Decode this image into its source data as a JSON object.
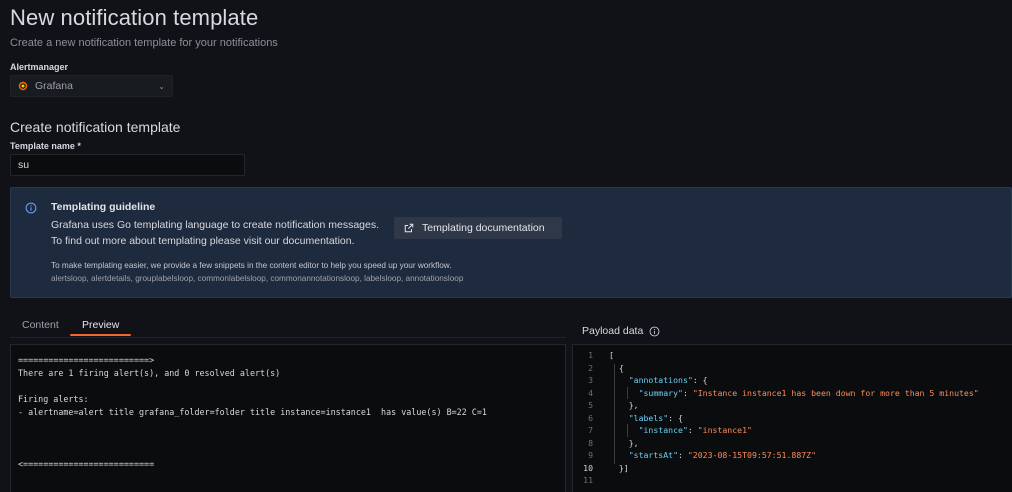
{
  "page": {
    "title": "New notification template",
    "subtitle": "Create a new notification template for your notifications"
  },
  "alertmanager": {
    "label": "Alertmanager",
    "selected": "Grafana",
    "logo_icon": "grafana-logo-icon",
    "chevron_icon": "chevron-down-icon"
  },
  "form": {
    "section_title": "Create notification template",
    "template_name_label": "Template name *",
    "template_name_value": "su"
  },
  "guideline": {
    "icon": "info-circle-icon",
    "title": "Templating guideline",
    "line1": "Grafana uses Go templating language to create notification messages.",
    "line2": "To find out more about templating please visit our documentation.",
    "button_label": "Templating documentation",
    "button_icon": "external-link-icon",
    "snippets_intro": "To make templating easier, we provide a few snippets in the content editor to help you speed up your workflow.",
    "snippets_list": "alertsloop, alertdetails, grouplabelsloop, commonlabelsloop, commonannotationsloop, labelsloop, annotationsloop"
  },
  "tabs": [
    {
      "label": "Content",
      "active": false
    },
    {
      "label": "Preview",
      "active": true
    }
  ],
  "preview": {
    "text": "==========================>\nThere are 1 firing alert(s), and 0 resolved alert(s)\n\nFiring alerts:\n- alertname=alert title grafana_folder=folder title instance=instance1  has value(s) B=22 C=1\n\n\n\n<=========================="
  },
  "payload": {
    "title": "Payload data",
    "info_icon": "info-circle-icon",
    "active_line": 10,
    "lines": [
      {
        "n": "1",
        "tokens": [
          {
            "t": "p",
            "v": "["
          }
        ]
      },
      {
        "n": "2",
        "tokens": [
          {
            "t": "p",
            "v": "  {"
          }
        ]
      },
      {
        "n": "3",
        "tokens": [
          {
            "t": "p",
            "v": "    "
          },
          {
            "t": "key",
            "v": "\"annotations\""
          },
          {
            "t": "p",
            "v": ": {"
          }
        ]
      },
      {
        "n": "4",
        "tokens": [
          {
            "t": "p",
            "v": "      "
          },
          {
            "t": "key",
            "v": "\"summary\""
          },
          {
            "t": "p",
            "v": ": "
          },
          {
            "t": "str",
            "v": "\"Instance instance1 has been down for more than 5 minutes\""
          }
        ]
      },
      {
        "n": "5",
        "tokens": [
          {
            "t": "p",
            "v": "    },"
          }
        ]
      },
      {
        "n": "6",
        "tokens": [
          {
            "t": "p",
            "v": "    "
          },
          {
            "t": "key",
            "v": "\"labels\""
          },
          {
            "t": "p",
            "v": ": {"
          }
        ]
      },
      {
        "n": "7",
        "tokens": [
          {
            "t": "p",
            "v": "      "
          },
          {
            "t": "key",
            "v": "\"instance\""
          },
          {
            "t": "p",
            "v": ": "
          },
          {
            "t": "str",
            "v": "\"instance1\""
          }
        ]
      },
      {
        "n": "8",
        "tokens": [
          {
            "t": "p",
            "v": "    },"
          }
        ]
      },
      {
        "n": "9",
        "tokens": [
          {
            "t": "p",
            "v": "    "
          },
          {
            "t": "key",
            "v": "\"startsAt\""
          },
          {
            "t": "p",
            "v": ": "
          },
          {
            "t": "str",
            "v": "\"2023-08-15T09:57:51.887Z\""
          }
        ]
      },
      {
        "n": "10",
        "tokens": [
          {
            "t": "p",
            "v": "  }]"
          }
        ]
      },
      {
        "n": "11",
        "tokens": []
      }
    ]
  },
  "colors": {
    "background": "#111217",
    "accent": "#f06929",
    "guideline_bg": "#1e2a3d",
    "json_key": "#6ccff6",
    "json_string": "#ff8a5b"
  }
}
